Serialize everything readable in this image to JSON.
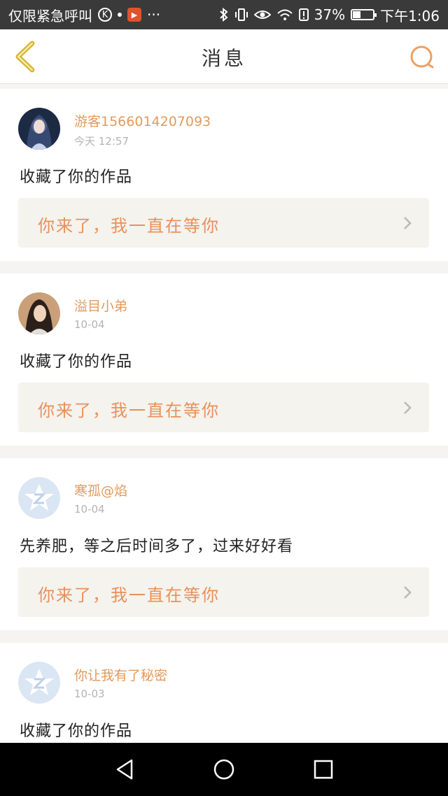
{
  "status_bar": {
    "carrier_text": "仅限紧急呼叫",
    "k_badge": "K",
    "app_badge": "▶",
    "more": "···",
    "battery_percent": "37%",
    "time": "下午1:06"
  },
  "header": {
    "title": "消息",
    "back_icon": "chevron-left-icon",
    "search_icon": "search-icon"
  },
  "colors": {
    "accent": "#e8905a",
    "username": "#e29a5e"
  },
  "messages": [
    {
      "username": "游客1566014207093",
      "time": "今天 12:57",
      "text": "收藏了你的作品",
      "quote": "你来了，我一直在等你",
      "avatar": "avatar-fantasy-girl"
    },
    {
      "username": "溢目小弟",
      "time": "10-04",
      "text": "收藏了你的作品",
      "quote": "你来了，我一直在等你",
      "avatar": "avatar-swordsman"
    },
    {
      "username": "寒孤@焰",
      "time": "10-04",
      "text": "先养肥，等之后时间多了，过来好好看",
      "quote": "你来了，我一直在等你",
      "avatar": "avatar-default-z"
    },
    {
      "username": "你让我有了秘密",
      "time": "10-03",
      "text": "收藏了你的作品",
      "quote": "",
      "avatar": "avatar-default-z"
    }
  ],
  "system_nav": [
    "back-triangle-icon",
    "home-circle-icon",
    "recents-square-icon"
  ]
}
